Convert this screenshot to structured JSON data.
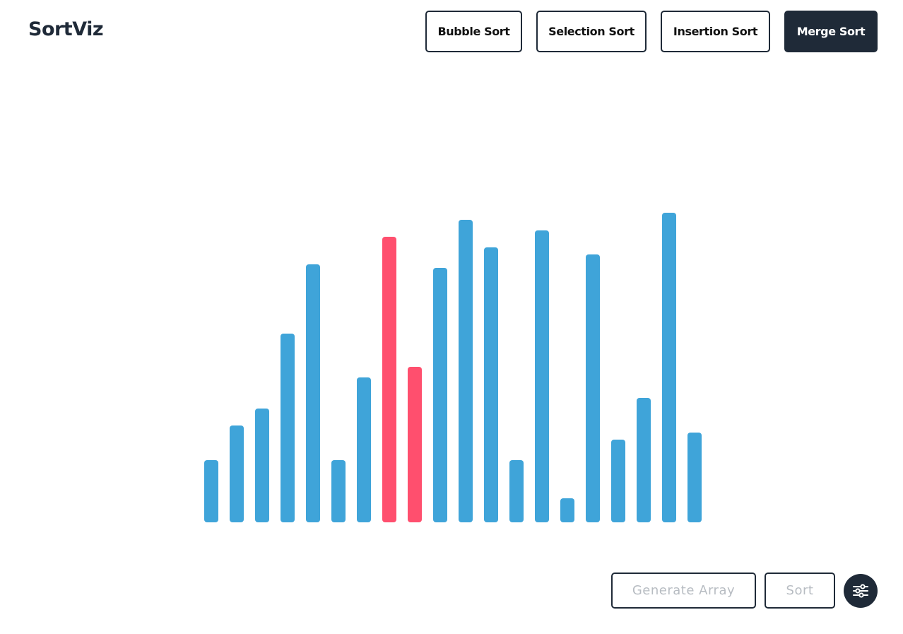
{
  "app": {
    "title": "SortViz"
  },
  "nav": {
    "items": [
      {
        "label": "Bubble Sort",
        "active": false
      },
      {
        "label": "Selection Sort",
        "active": false
      },
      {
        "label": "Insertion Sort",
        "active": false
      },
      {
        "label": "Merge Sort",
        "active": true
      }
    ]
  },
  "controls": {
    "generate_label": "Generate Array",
    "sort_label": "Sort",
    "generate_disabled": true,
    "sort_disabled": true,
    "settings_icon": "sliders-icon"
  },
  "colors": {
    "bar_default": "#3fa4d9",
    "bar_compare": "#ff4f6e",
    "primary_dark": "#1f2a38"
  },
  "chart_data": {
    "type": "bar",
    "values": [
      88,
      137,
      161,
      268,
      366,
      88,
      205,
      405,
      220,
      361,
      429,
      390,
      88,
      414,
      34,
      380,
      117,
      176,
      439,
      127
    ],
    "highlighted_indices": [
      7,
      8
    ],
    "ylim": [
      0,
      440
    ]
  }
}
